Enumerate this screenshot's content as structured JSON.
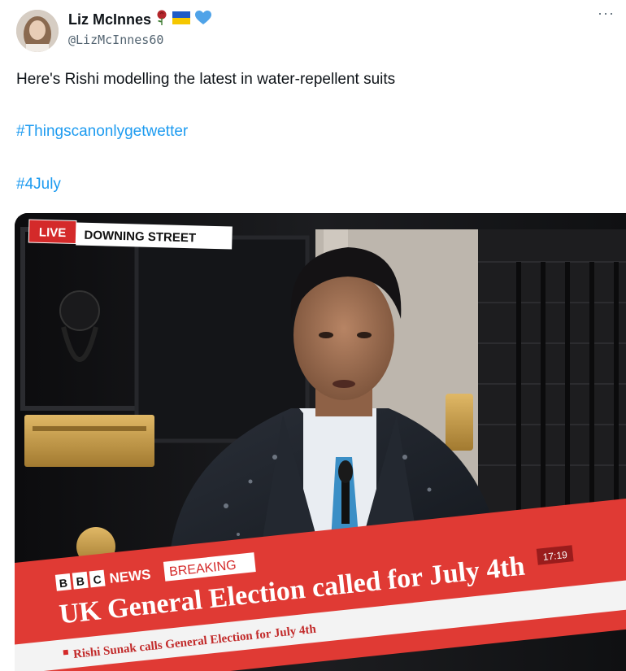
{
  "tweet": {
    "author": {
      "display_name": "Liz McInnes",
      "handle": "@LizMcInnes60",
      "badges": [
        "rose-icon",
        "ukraine-flag-icon",
        "blue-heart-icon"
      ]
    },
    "text": "Here's Rishi modelling the latest in water-repellent suits",
    "hashtags": [
      "#Thingscanonlygetwetter",
      "#4July"
    ],
    "more_menu": "···",
    "colors": {
      "link": "#1d9bf0",
      "secondary": "#536471"
    }
  },
  "media": {
    "live_badge": "LIVE",
    "location": "DOWNING STREET",
    "bbc_letters": [
      "B",
      "B",
      "C"
    ],
    "news_label": "NEWS",
    "breaking_label": "BREAKING",
    "time": "17:19",
    "headline": "UK General Election called for July 4th",
    "ticker": "Rishi Sunak calls General Election for July 4th",
    "colors": {
      "bbc_red": "#d42a2a",
      "banner_red": "#e03a34"
    }
  }
}
